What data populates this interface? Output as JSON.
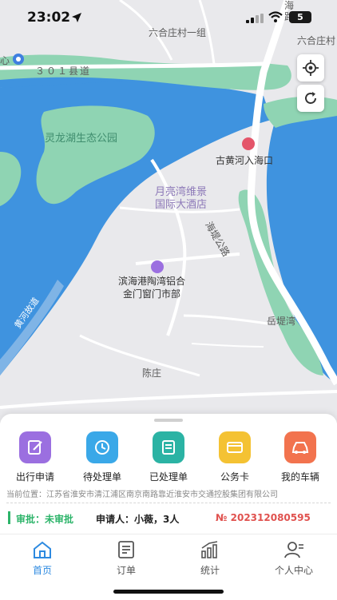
{
  "status_bar": {
    "time": "23:02",
    "battery": "5"
  },
  "map": {
    "labels": {
      "village_top": "六合庄村一组",
      "village_right": "六合庄村",
      "road_301": "３０１县道",
      "road_left_partial": "心",
      "park": "灵龙湖生态公园",
      "hotel": "月亮湾维景\n国际大酒店",
      "estuary": "古黄河入海口",
      "poi": "滨海港陶湾铝合\n金门窗门市部",
      "haiti_road": "海堤公路",
      "yuedi_bay": "岳堤湾",
      "chen_village": "陈庄",
      "river_road": "黄河故道",
      "top_road_partial": "海\n路"
    }
  },
  "actions": [
    {
      "label": "出行申请",
      "icon": "edit-form-icon",
      "color": "#9b6fe0"
    },
    {
      "label": "待处理单",
      "icon": "pending-user-icon",
      "color": "#3aa8e8"
    },
    {
      "label": "已处理单",
      "icon": "processed-doc-icon",
      "color": "#2bb3a4"
    },
    {
      "label": "公务卡",
      "icon": "card-icon",
      "color": "#f4c233"
    },
    {
      "label": "我的车辆",
      "icon": "car-icon",
      "color": "#f2734e"
    }
  ],
  "location": {
    "prefix": "当前位置：",
    "address": "江苏省淮安市清江浦区南京南路靠近淮安市交通控股集团有限公司"
  },
  "approval": {
    "status": "审批：未审批",
    "applicant": "申请人：小薇，3人",
    "order_no": "№ 202312080595"
  },
  "tabs": [
    {
      "label": "首页",
      "icon": "home-icon",
      "active": true
    },
    {
      "label": "订单",
      "icon": "order-icon",
      "active": false
    },
    {
      "label": "统计",
      "icon": "stats-icon",
      "active": false
    },
    {
      "label": "个人中心",
      "icon": "profile-icon",
      "active": false
    }
  ]
}
